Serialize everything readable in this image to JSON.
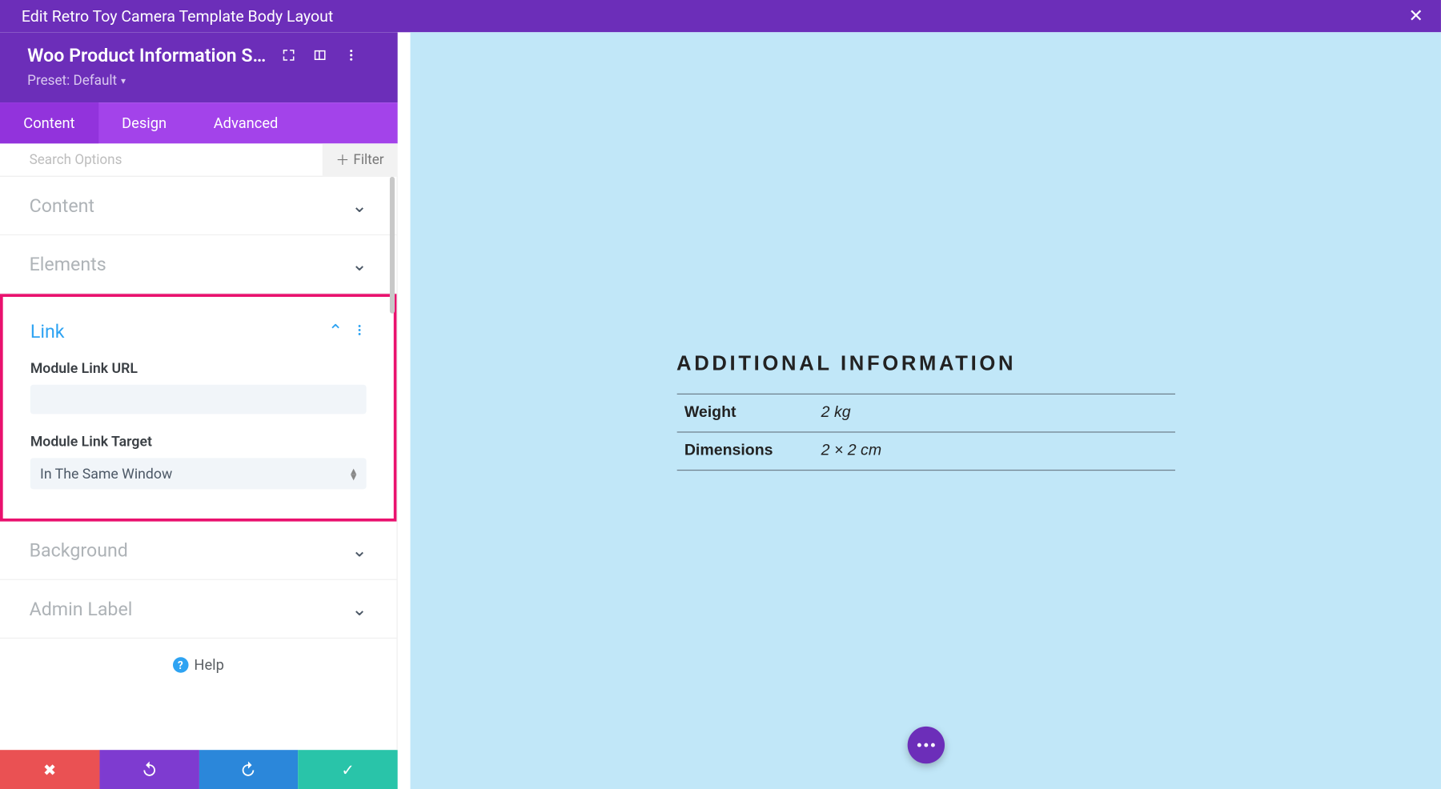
{
  "titlebar": {
    "title": "Edit Retro Toy Camera Template Body Layout"
  },
  "module": {
    "title": "Woo Product Information S…",
    "preset_label": "Preset: Default"
  },
  "tabs": [
    "Content",
    "Design",
    "Advanced"
  ],
  "search": {
    "placeholder": "Search Options"
  },
  "filter_label": "Filter",
  "sections": {
    "content": "Content",
    "elements": "Elements",
    "link": "Link",
    "background": "Background",
    "admin_label": "Admin Label"
  },
  "link_fields": {
    "url_label": "Module Link URL",
    "url_value": "",
    "target_label": "Module Link Target",
    "target_value": "In The Same Window"
  },
  "help_label": "Help",
  "preview": {
    "heading": "ADDITIONAL INFORMATION",
    "rows": [
      {
        "label": "Weight",
        "value": "2 kg"
      },
      {
        "label": "Dimensions",
        "value": "2 × 2 cm"
      }
    ]
  }
}
